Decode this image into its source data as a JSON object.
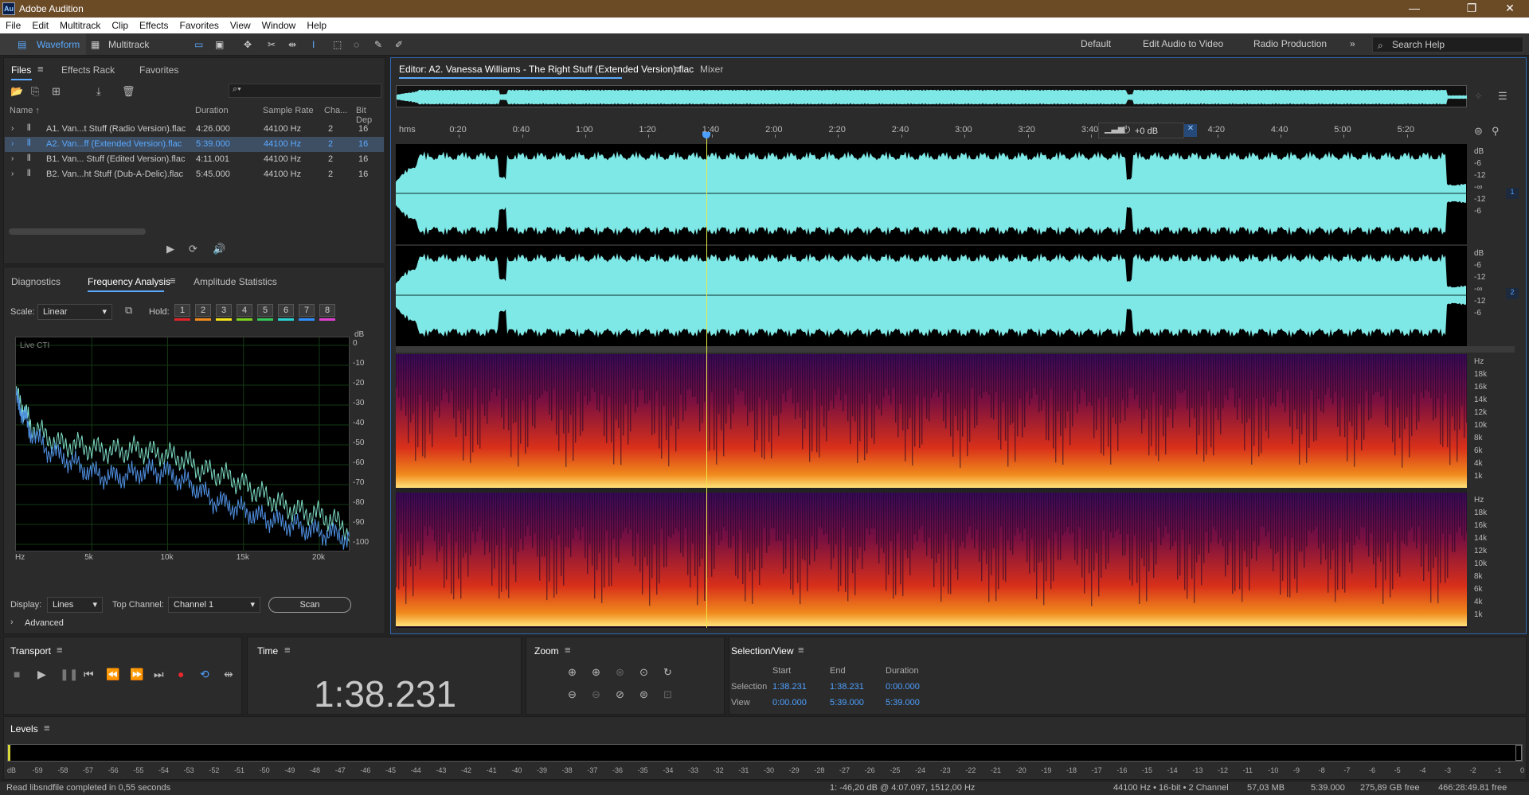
{
  "window": {
    "title": "Adobe Audition",
    "logo": "Au"
  },
  "menu": [
    "File",
    "Edit",
    "Multitrack",
    "Clip",
    "Effects",
    "Favorites",
    "View",
    "Window",
    "Help"
  ],
  "toolbar": {
    "waveform_label": "Waveform",
    "multitrack_label": "Multitrack"
  },
  "workspaces": [
    "Default",
    "Edit Audio to Video",
    "Radio Production"
  ],
  "search": {
    "placeholder": "Search Help"
  },
  "files_panel": {
    "tabs": [
      "Files",
      "Effects Rack",
      "Favorites"
    ],
    "columns": [
      "Name ↑",
      "Duration",
      "Sample Rate",
      "Cha...",
      "Bit Dep"
    ],
    "rows": [
      {
        "name": "A1. Van...t Stuff (Radio Version).flac",
        "duration": "4:26.000",
        "rate": "44100 Hz",
        "ch": "2",
        "bits": "16"
      },
      {
        "name": "A2. Van...ff (Extended Version).flac",
        "duration": "5:39.000",
        "rate": "44100 Hz",
        "ch": "2",
        "bits": "16"
      },
      {
        "name": "B1. Van... Stuff (Edited Version).flac",
        "duration": "4:11.001",
        "rate": "44100 Hz",
        "ch": "2",
        "bits": "16"
      },
      {
        "name": "B2. Van...ht Stuff (Dub-A-Delic).flac",
        "duration": "5:45.000",
        "rate": "44100 Hz",
        "ch": "2",
        "bits": "16"
      }
    ],
    "selected_index": 1
  },
  "analysis_panel": {
    "tabs": [
      "Diagnostics",
      "Frequency Analysis",
      "Amplitude Statistics"
    ],
    "scale_label": "Scale:",
    "scale_value": "Linear",
    "hold_label": "Hold:",
    "hold_slots": [
      "1",
      "2",
      "3",
      "4",
      "5",
      "6",
      "7",
      "8"
    ],
    "hold_colors": [
      "#e0242a",
      "#f08a1c",
      "#f5e41a",
      "#7ed321",
      "#34c759",
      "#2ad1d1",
      "#2f8fff",
      "#e040d0"
    ],
    "live_cti_label": "Live CTI",
    "display_label": "Display:",
    "display_value": "Lines",
    "top_channel_label": "Top Channel:",
    "top_channel_value": "Channel 1",
    "scan_label": "Scan",
    "advanced_label": "Advanced"
  },
  "chart_data": {
    "type": "line",
    "xlabel": "",
    "ylabel": "",
    "x_ticks": [
      "Hz",
      "5k",
      "10k",
      "15k",
      "20k"
    ],
    "y_unit": "dB",
    "y_ticks": [
      "0",
      "-10",
      "-20",
      "-30",
      "-40",
      "-50",
      "-60",
      "-70",
      "-80",
      "-90",
      "-100"
    ],
    "xlim": [
      0,
      22050
    ],
    "ylim": [
      -100,
      0
    ],
    "series": [
      {
        "color": "#7fe0c8",
        "x": [
          0,
          500,
          1000,
          2000,
          3000,
          4000,
          5000,
          6000,
          7000,
          8000,
          9000,
          10000,
          11000,
          12000,
          13000,
          14000,
          15000,
          16000,
          17000,
          18000,
          19000,
          20000,
          21000,
          22050
        ],
        "y": [
          -25,
          -32,
          -40,
          -46,
          -50,
          -50,
          -52,
          -53,
          -53,
          -52,
          -54,
          -55,
          -57,
          -62,
          -64,
          -66,
          -70,
          -74,
          -78,
          -82,
          -84,
          -85,
          -88,
          -94
        ]
      },
      {
        "color": "#4f8fe0",
        "x": [
          0,
          500,
          1000,
          2000,
          3000,
          4000,
          5000,
          6000,
          7000,
          8000,
          9000,
          10000,
          11000,
          12000,
          13000,
          14000,
          15000,
          16000,
          17000,
          18000,
          19000,
          20000,
          21000,
          22050
        ],
        "y": [
          -27,
          -35,
          -44,
          -52,
          -56,
          -60,
          -64,
          -66,
          -66,
          -64,
          -63,
          -64,
          -68,
          -72,
          -78,
          -80,
          -83,
          -86,
          -88,
          -90,
          -92,
          -94,
          -95,
          -97
        ]
      }
    ]
  },
  "editor": {
    "tab_label": "Editor: A2. Vanessa Williams - The Right Stuff (Extended Version).flac",
    "mixer_label": "Mixer",
    "ruler_unit": "hms",
    "ruler_ticks": [
      "0:20",
      "0:40",
      "1:00",
      "1:20",
      "1:40",
      "2:00",
      "2:20",
      "2:40",
      "3:00",
      "3:20",
      "3:40",
      "4:00",
      "4:20",
      "4:40",
      "5:00",
      "5:20"
    ],
    "duration_seconds": 339,
    "playhead_seconds": 98.231,
    "hud_gain": "+0 dB",
    "wave_db_labels": [
      "dB",
      "-6",
      "-12",
      "-∞",
      "-12",
      "-6"
    ],
    "channel_badges": [
      "1",
      "2"
    ],
    "spec_labels": [
      "Hz",
      "18k",
      "16k",
      "14k",
      "12k",
      "10k",
      "8k",
      "6k",
      "4k",
      "1k"
    ],
    "waveform_color": "#7ee8e6"
  },
  "transport": {
    "title": "Transport"
  },
  "time": {
    "title": "Time",
    "value": "1:38.231"
  },
  "zoom": {
    "title": "Zoom"
  },
  "selection_view": {
    "title": "Selection/View",
    "col_start": "Start",
    "col_end": "End",
    "col_duration": "Duration",
    "selection_label": "Selection",
    "selection_start": "1:38.231",
    "selection_end": "1:38.231",
    "selection_duration": "0:00.000",
    "view_label": "View",
    "view_start": "0:00.000",
    "view_end": "5:39.000",
    "view_duration": "5:39.000"
  },
  "levels": {
    "title": "Levels",
    "scale": [
      "dB",
      "-59",
      "-58",
      "-57",
      "-56",
      "-55",
      "-54",
      "-53",
      "-52",
      "-51",
      "-50",
      "-49",
      "-48",
      "-47",
      "-46",
      "-45",
      "-44",
      "-43",
      "-42",
      "-41",
      "-40",
      "-39",
      "-38",
      "-37",
      "-36",
      "-35",
      "-34",
      "-33",
      "-32",
      "-31",
      "-30",
      "-29",
      "-28",
      "-27",
      "-26",
      "-25",
      "-24",
      "-23",
      "-22",
      "-21",
      "-20",
      "-19",
      "-18",
      "-17",
      "-16",
      "-15",
      "-14",
      "-13",
      "-12",
      "-11",
      "-10",
      "-9",
      "-8",
      "-7",
      "-6",
      "-5",
      "-4",
      "-3",
      "-2",
      "-1",
      "0"
    ]
  },
  "status": {
    "message": "Read libsndfile completed in 0,55 seconds",
    "cursor": "1: -46,20 dB @ 4:07.097, 1512,00 Hz",
    "format": "44100 Hz • 16-bit • 2 Channel",
    "size": "57,03 MB",
    "duration": "5:39.000",
    "free": "275,89 GB free",
    "free_time": "466:28:49.81 free"
  }
}
